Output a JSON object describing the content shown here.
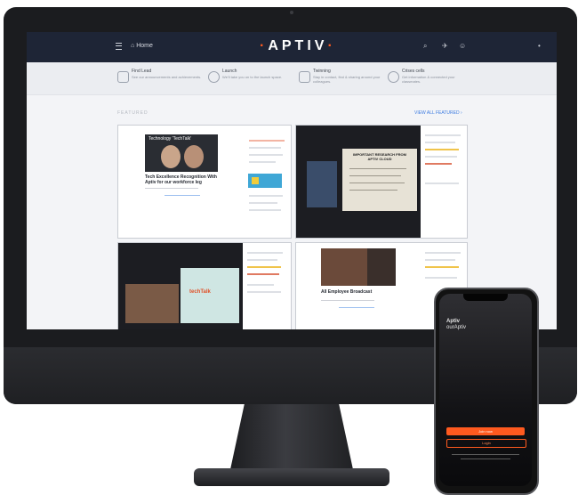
{
  "header": {
    "home_label": "Home",
    "logo": "APTIV",
    "logo_dots": "·"
  },
  "quick_links": [
    {
      "title": "Find Lead",
      "desc": "See our announcements and achievements."
    },
    {
      "title": "Launch",
      "desc": "We'll take you on to the launch space."
    },
    {
      "title": "Twinning",
      "desc": "Stay in contact, find & sharing around your colleagues."
    },
    {
      "title": "Crises cells",
      "desc": "Get information & connected your classmates."
    }
  ],
  "featured": {
    "label": "FEATURED",
    "view_all": "VIEW ALL FEATURED"
  },
  "cards": [
    {
      "banner": "Technology 'TechTalk'",
      "caption": "Tech Excellence Recognition With Aptiv for our workforce leg"
    },
    {
      "banner": "IMPORTANT RESEARCH FROM APTIV CLOUD"
    },
    {
      "banner": "techTalk"
    },
    {
      "caption": "All Employee Broadcast"
    }
  ],
  "phone": {
    "logo_line1": "Aptiv",
    "logo_line2": "ourAptiv",
    "primary_button": "Join now",
    "secondary_button": "Login"
  },
  "colors": {
    "accent": "#ff5a1f",
    "header_bg": "#1e2536",
    "link": "#3d7be0"
  }
}
